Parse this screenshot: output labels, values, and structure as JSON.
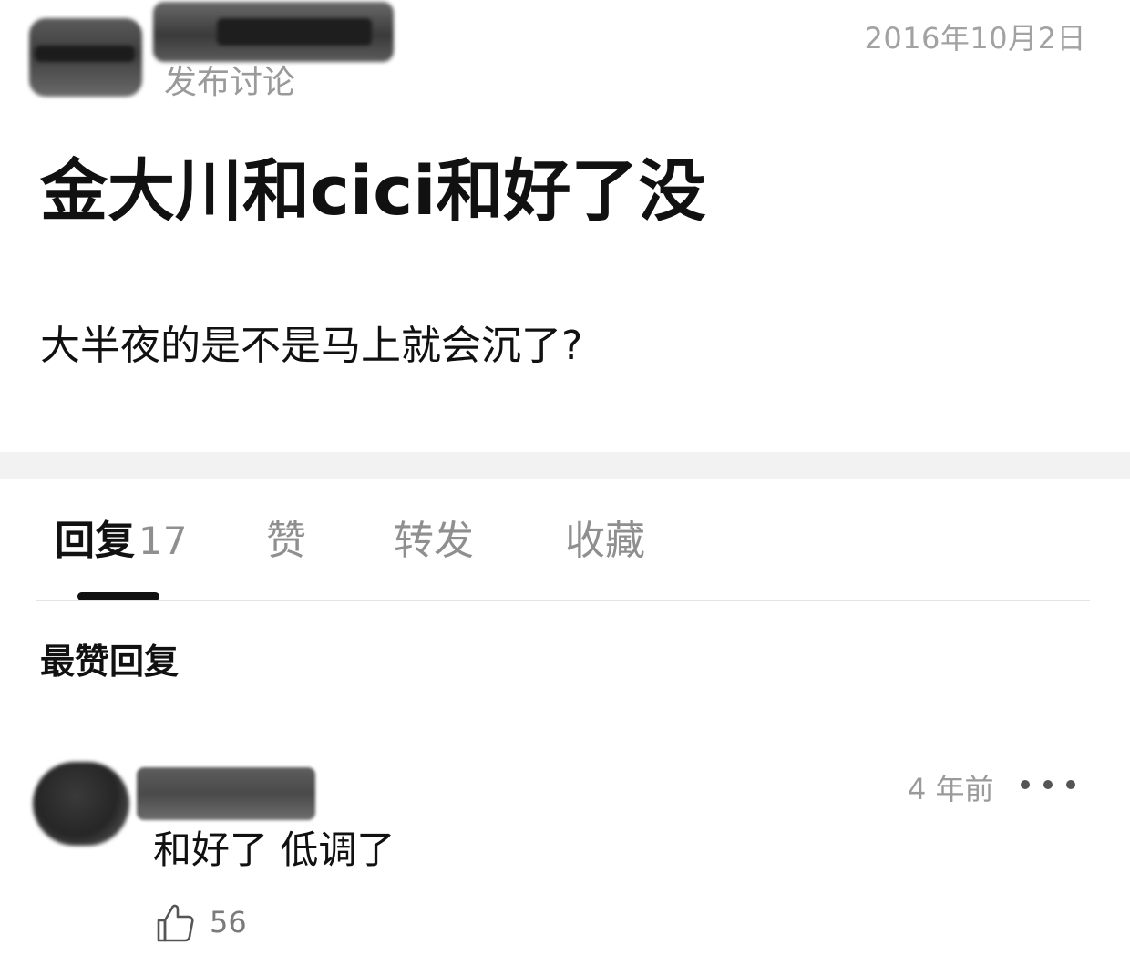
{
  "post": {
    "action": "发布讨论",
    "date": "2016年10月2日",
    "title": "金大川和cici和好了没",
    "content": "大半夜的是不是马上就会沉了?"
  },
  "tabs": {
    "reply_label": "回复",
    "reply_count": "17",
    "like_label": "赞",
    "share_label": "转发",
    "favorite_label": "收藏",
    "active": "reply"
  },
  "replies": {
    "section_title": "最赞回复",
    "items": [
      {
        "time": "4 年前",
        "text": "和好了 低调了",
        "likes": "56"
      }
    ]
  },
  "colors": {
    "text_primary": "#111111",
    "text_secondary": "#9a9a9a",
    "divider": "#f2f2f2",
    "tab_indicator": "#111111"
  },
  "icons": {
    "like": "thumbs-up-icon",
    "more": "more-horizontal-icon"
  }
}
